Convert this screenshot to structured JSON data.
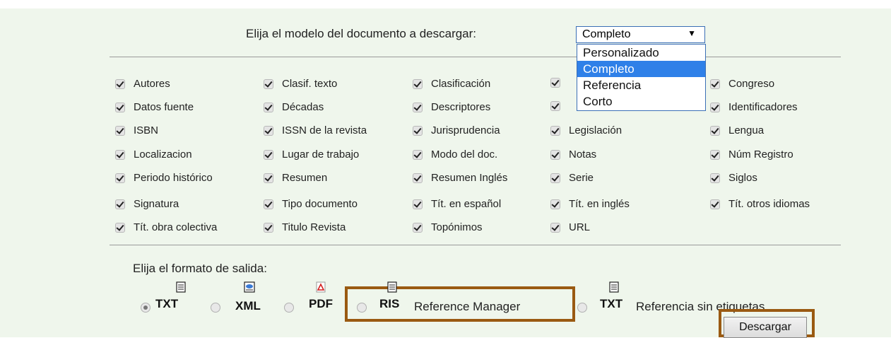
{
  "model": {
    "label": "Elija el modelo del documento a descargar:",
    "selected": "Completo",
    "options": [
      "Personalizado",
      "Completo",
      "Referencia",
      "Corto"
    ]
  },
  "fields": {
    "col1": [
      "Autores",
      "Datos fuente",
      "ISBN",
      "Localizacion",
      "Periodo histórico",
      "Signatura",
      "Tít. obra colectiva"
    ],
    "col2": [
      "Clasif. texto",
      "Décadas",
      "ISSN de la revista",
      "Lugar de trabajo",
      "Resumen",
      "Tipo documento",
      "Titulo Revista"
    ],
    "col3": [
      "Clasificación",
      "Descriptores",
      "Jurisprudencia",
      "Modo del doc.",
      "Resumen Inglés",
      "Tít. en español",
      "Topónimos"
    ],
    "col4": [
      "",
      "",
      "Legislación",
      "Notas",
      "Serie",
      "Tít. en inglés",
      "URL"
    ],
    "col5": [
      "Congreso",
      "Identificadores",
      "Lengua",
      "Núm Registro",
      "Siglos",
      "Tít. otros idiomas"
    ]
  },
  "output": {
    "label": "Elija el formato de salida:",
    "formats": [
      {
        "code": "TXT",
        "text": "",
        "selected": true,
        "icon": "text-file-icon"
      },
      {
        "code": "XML",
        "text": "",
        "selected": false,
        "icon": "xml-file-icon"
      },
      {
        "code": "PDF",
        "text": "",
        "selected": false,
        "icon": "pdf-file-icon"
      },
      {
        "code": "RIS",
        "text": "Reference Manager",
        "selected": false,
        "icon": "text-file-icon"
      },
      {
        "code": "TXT",
        "text": "Referencia sin etiquetas",
        "selected": false,
        "icon": "text-file-icon"
      }
    ],
    "download_label": "Descargar"
  },
  "colors": {
    "highlight": "#9a5a12",
    "selected_option": "#2f80e8",
    "background": "#eff6ec"
  }
}
